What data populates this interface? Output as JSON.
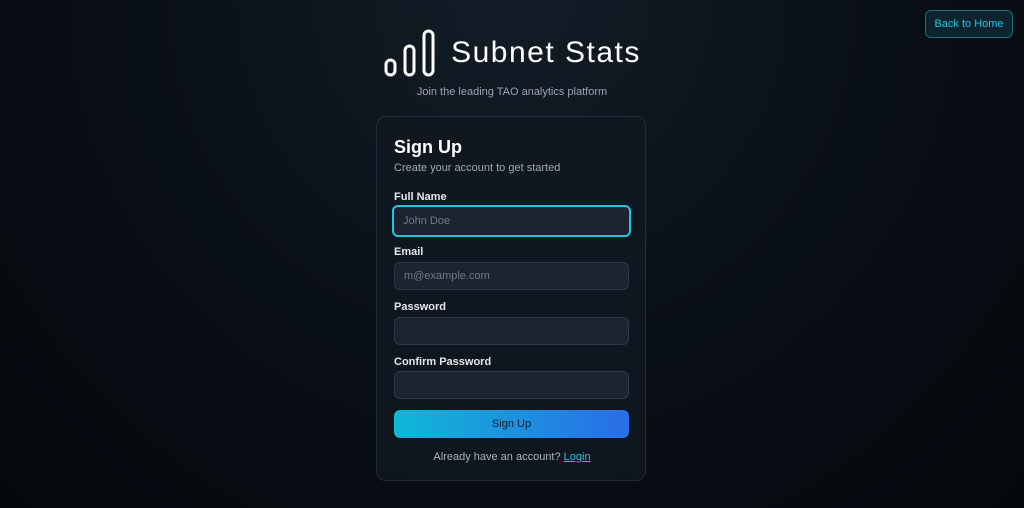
{
  "header": {
    "back_label": "Back to Home"
  },
  "brand": {
    "name": "Subnet Stats",
    "tagline": "Join the leading TAO analytics platform",
    "logo_icon": "bar-chart-icon"
  },
  "form": {
    "title": "Sign Up",
    "subtitle": "Create your account to get started",
    "fields": [
      {
        "label": "Full Name",
        "placeholder": "John Doe",
        "value": ""
      },
      {
        "label": "Email",
        "placeholder": "m@example.com",
        "value": ""
      },
      {
        "label": "Password",
        "placeholder": "",
        "value": ""
      },
      {
        "label": "Confirm Password",
        "placeholder": "",
        "value": ""
      }
    ],
    "submit_label": "Sign Up",
    "footer_text": "Already have an account?",
    "login_label": "Login"
  },
  "colors": {
    "accent": "#22c5e0",
    "gradient_start": "#0fb8d6",
    "gradient_end": "#2a6de8",
    "background": "#0b1119"
  }
}
